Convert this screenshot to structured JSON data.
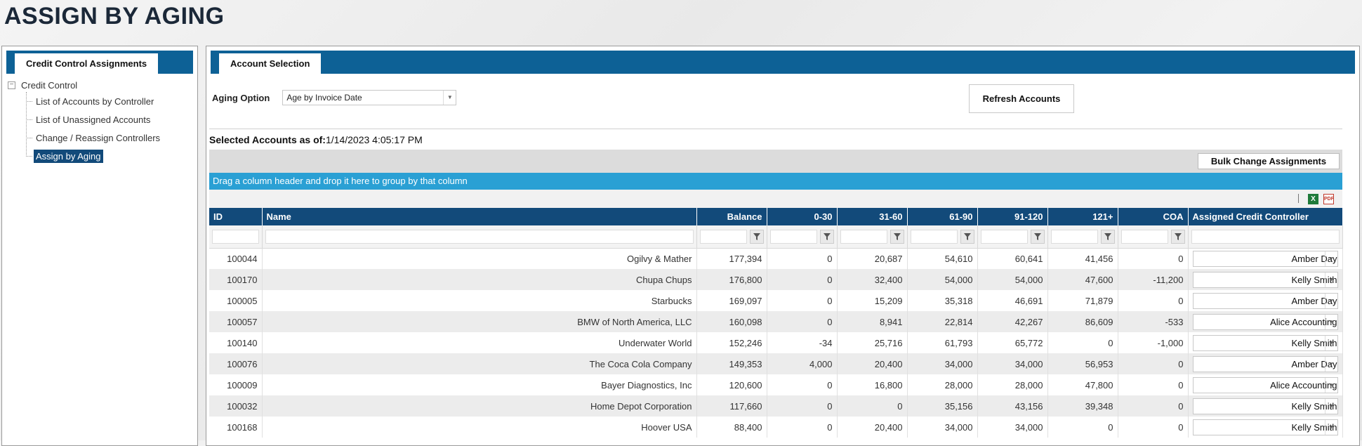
{
  "page": {
    "title": "ASSIGN BY AGING"
  },
  "left_panel": {
    "tab": "Credit Control Assignments",
    "tree": {
      "root_toggle": "−",
      "root": "Credit Control",
      "items": [
        {
          "label": "List of Accounts by Controller",
          "selected": false
        },
        {
          "label": "List of Unassigned Accounts",
          "selected": false
        },
        {
          "label": "Change / Reassign Controllers",
          "selected": false
        },
        {
          "label": "Assign by Aging",
          "selected": true
        }
      ]
    }
  },
  "right_panel": {
    "tab": "Account Selection",
    "aging_option": {
      "label": "Aging Option",
      "value": "Age by Invoice Date"
    },
    "refresh_button": "Refresh Accounts",
    "selected_heading": {
      "label": "Selected Accounts as of:",
      "timestamp": "1/14/2023 4:05:17 PM"
    },
    "bulk_button": "Bulk Change Assignments",
    "group_hint": "Drag a column header and drop it here to group by that column",
    "export": {
      "excel_icon": "excel-icon",
      "pdf_icon": "pdf-icon",
      "excel_glyph": "X",
      "pdf_glyph": "PDF"
    }
  },
  "grid": {
    "columns": [
      "ID",
      "Name",
      "Balance",
      "0-30",
      "31-60",
      "61-90",
      "91-120",
      "121+",
      "COA",
      "Assigned Credit Controller"
    ],
    "rows": [
      {
        "id": "100044",
        "name": "Ogilvy & Mather",
        "balance": "177,394",
        "d0_30": "0",
        "d31_60": "20,687",
        "d61_90": "54,610",
        "d91_120": "60,641",
        "d121": "41,456",
        "coa": "0",
        "controller": "Amber Day"
      },
      {
        "id": "100170",
        "name": "Chupa Chups",
        "balance": "176,800",
        "d0_30": "0",
        "d31_60": "32,400",
        "d61_90": "54,000",
        "d91_120": "54,000",
        "d121": "47,600",
        "coa": "-11,200",
        "controller": "Kelly Smith"
      },
      {
        "id": "100005",
        "name": "Starbucks",
        "balance": "169,097",
        "d0_30": "0",
        "d31_60": "15,209",
        "d61_90": "35,318",
        "d91_120": "46,691",
        "d121": "71,879",
        "coa": "0",
        "controller": "Amber Day"
      },
      {
        "id": "100057",
        "name": "BMW of North America, LLC",
        "balance": "160,098",
        "d0_30": "0",
        "d31_60": "8,941",
        "d61_90": "22,814",
        "d91_120": "42,267",
        "d121": "86,609",
        "coa": "-533",
        "controller": "Alice Accounting"
      },
      {
        "id": "100140",
        "name": "Underwater World",
        "balance": "152,246",
        "d0_30": "-34",
        "d31_60": "25,716",
        "d61_90": "61,793",
        "d91_120": "65,772",
        "d121": "0",
        "coa": "-1,000",
        "controller": "Kelly Smith"
      },
      {
        "id": "100076",
        "name": "The Coca Cola Company",
        "balance": "149,353",
        "d0_30": "4,000",
        "d31_60": "20,400",
        "d61_90": "34,000",
        "d91_120": "34,000",
        "d121": "56,953",
        "coa": "0",
        "controller": "Amber Day"
      },
      {
        "id": "100009",
        "name": "Bayer Diagnostics, Inc",
        "balance": "120,600",
        "d0_30": "0",
        "d31_60": "16,800",
        "d61_90": "28,000",
        "d91_120": "28,000",
        "d121": "47,800",
        "coa": "0",
        "controller": "Alice Accounting"
      },
      {
        "id": "100032",
        "name": "Home Depot Corporation",
        "balance": "117,660",
        "d0_30": "0",
        "d31_60": "0",
        "d61_90": "35,156",
        "d91_120": "43,156",
        "d121": "39,348",
        "coa": "0",
        "controller": "Kelly Smith"
      },
      {
        "id": "100168",
        "name": "Hoover USA",
        "balance": "88,400",
        "d0_30": "0",
        "d31_60": "20,400",
        "d61_90": "34,000",
        "d91_120": "34,000",
        "d121": "0",
        "coa": "0",
        "controller": "Kelly Smith"
      }
    ]
  },
  "colors": {
    "header_blue": "#124a7a",
    "tabstrip_blue": "#0d6196",
    "group_bar": "#2aa0d4",
    "link": "#2a7ab8"
  }
}
